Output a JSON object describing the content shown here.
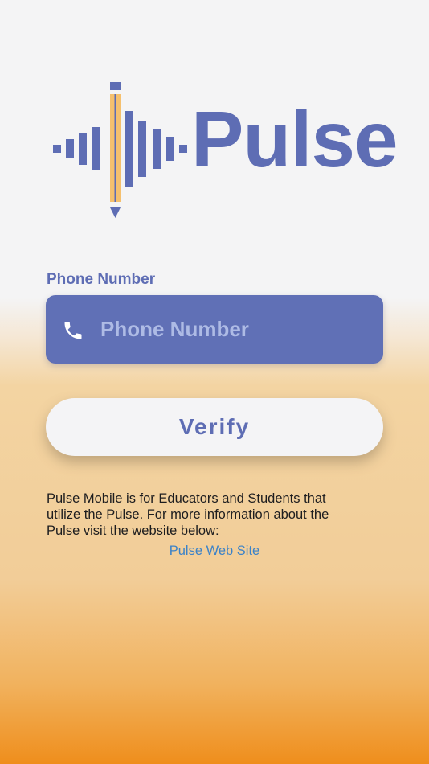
{
  "logo": {
    "wordmark": "Pulse",
    "brand_color": "#5e6db4",
    "pencil_color": "#f5c06e"
  },
  "form": {
    "phone_label": "Phone Number",
    "phone_placeholder": "Phone Number",
    "phone_value": "",
    "phone_icon": "phone-icon",
    "verify_label": "Verify"
  },
  "info": {
    "text": "Pulse Mobile is for Educators and Students that\nutilize the Pulse.  For more information about the\nPulse visit the website below:",
    "link_label": "Pulse Web Site"
  },
  "colors": {
    "field_background": "#6070b6",
    "link": "#3b82c8",
    "gradient_bottom": "#ef8e1c"
  }
}
